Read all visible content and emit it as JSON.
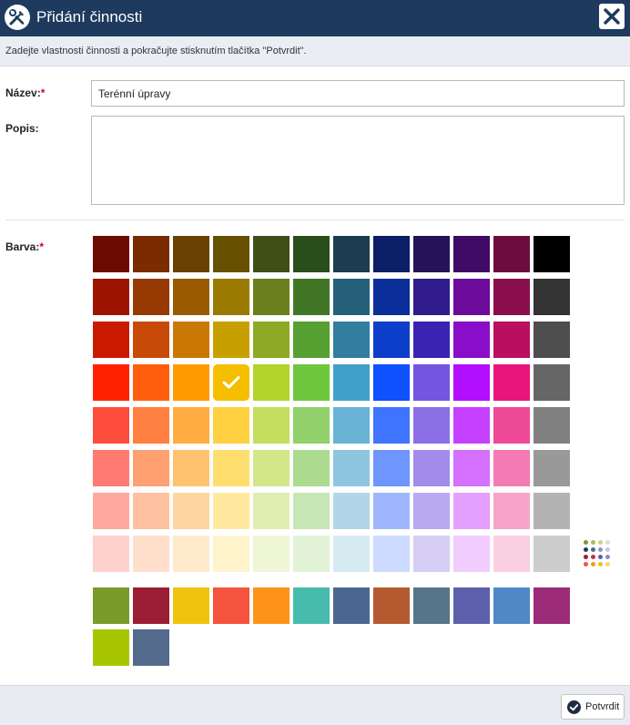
{
  "dialog": {
    "title": "Přidání činnosti",
    "info": "Zadejte vlastnosti činnosti a pokračujte stisknutím tlačítka \"Potvrdit\".",
    "title_icon": "tools-icon",
    "close_icon": "close-icon"
  },
  "form": {
    "name_label": "Název:",
    "name_value": "Terénní úpravy",
    "desc_label": "Popis:",
    "desc_value": "",
    "color_label": "Barva:",
    "required_mark": "*"
  },
  "palette": {
    "columns": 12,
    "rows": [
      [
        "#6b0a00",
        "#7a2b00",
        "#6b4000",
        "#665000",
        "#404f16",
        "#2a4e1a",
        "#1b3d4f",
        "#0a1f66",
        "#241457",
        "#400b66",
        "#6b0d3c",
        "#000000"
      ],
      [
        "#9c1400",
        "#973a04",
        "#9a5b00",
        "#9a7a00",
        "#6b7f1e",
        "#417626",
        "#25607a",
        "#0b2f9b",
        "#2f1c8a",
        "#6b0a9b",
        "#8a0e4e",
        "#333333"
      ],
      [
        "#cc1a00",
        "#c94a06",
        "#c97806",
        "#c7a000",
        "#8ea923",
        "#569f31",
        "#337d9e",
        "#0d3ec9",
        "#3a22b3",
        "#8a0dc9",
        "#b80f60",
        "#4d4d4d"
      ],
      [
        "#ff2200",
        "#ff5e0c",
        "#ff9a00",
        "#f5bf00",
        "#b3d42c",
        "#6ec63d",
        "#41a0c9",
        "#0f50ff",
        "#7355e0",
        "#b30fff",
        "#e8167c",
        "#666666"
      ],
      [
        "#ff4d3b",
        "#ff8040",
        "#ffad40",
        "#ffd040",
        "#c5dd5f",
        "#91d06a",
        "#68b3d5",
        "#3f74ff",
        "#8b6fe6",
        "#c540ff",
        "#ee4a97",
        "#808080"
      ],
      [
        "#ff7a70",
        "#ffa070",
        "#ffc36f",
        "#ffde70",
        "#d4e68a",
        "#acdb8f",
        "#8fc5de",
        "#6f96ff",
        "#a28ceb",
        "#d670ff",
        "#f37ab3",
        "#999999"
      ],
      [
        "#ffa89f",
        "#ffc19f",
        "#ffd59f",
        "#ffe99f",
        "#e2eeb1",
        "#c6e6b4",
        "#b2d6e7",
        "#9fb7ff",
        "#b9a9f0",
        "#e49fff",
        "#f6a4ca",
        "#b3b3b3"
      ],
      [
        "#ffd1cc",
        "#ffdfcc",
        "#ffeacc",
        "#fff4cc",
        "#eef6d6",
        "#e1f2d7",
        "#d6eaf2",
        "#ccdbff",
        "#d7cef6",
        "#f1ccff",
        "#fbd0e3",
        "#cccccc"
      ]
    ],
    "selected": [
      3,
      3
    ],
    "check_icon": "check-icon"
  },
  "recent_colors": [
    "#7a9a2a",
    "#9c1e36",
    "#f0c30f",
    "#f5533d",
    "#ff9319",
    "#47bbae",
    "#4a6791",
    "#b55a30",
    "#56748a",
    "#5e5faa",
    "#4f88c6",
    "#9c2b7a",
    "#a8c600",
    "#546a8c"
  ],
  "more_colors": {
    "icon": "color-grid-icon",
    "dots": [
      "#7a9a2a",
      "#a5c05a",
      "#c5d690",
      "#d8e3b8",
      "#1e3a5f",
      "#4f6b8f",
      "#8a9bb5",
      "#c2ccd8",
      "#9c1e36",
      "#c0304a",
      "#5e5faa",
      "#8a8ac8",
      "#f5533d",
      "#ff9319",
      "#f0c30f",
      "#ffd46e"
    ]
  },
  "footer": {
    "confirm_label": "Potvrdit",
    "confirm_icon": "check-circle-icon"
  }
}
